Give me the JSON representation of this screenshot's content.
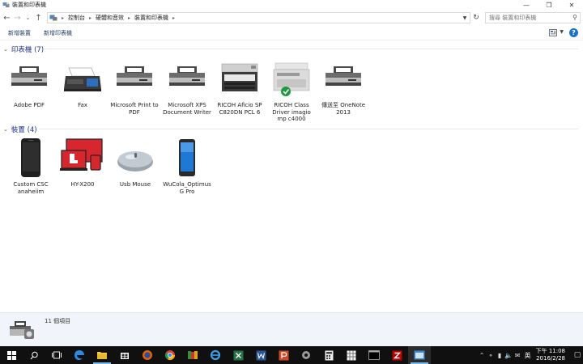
{
  "window": {
    "title": "裝置和印表機"
  },
  "address": {
    "crumbs": [
      "控制台",
      "硬體和音效",
      "裝置和印表機"
    ],
    "search_placeholder": "搜尋 裝置和印表機"
  },
  "commands": {
    "add_device": "新增裝置",
    "add_printer": "新增印表機"
  },
  "groups": {
    "printers": {
      "label": "印表機 (7)",
      "items": [
        "Adobe PDF",
        "Fax",
        "Microsoft Print to PDF",
        "Microsoft XPS Document Writer",
        "RICOH Aficio SP C820DN PCL 6",
        "RICOH Class Driver imagio mp c4000",
        "傳送至 OneNote 2013"
      ]
    },
    "devices": {
      "label": "裝置 (4)",
      "items": [
        "Custom CSC anaheiim",
        "HY-X200",
        "Usb Mouse",
        "WuCola_Optimus G Pro"
      ]
    }
  },
  "details": {
    "count": "11 個項目"
  },
  "taskbar": {
    "lang": "英",
    "time": "下午 11:08",
    "date": "2016/2/28"
  },
  "colors": {
    "accent": "#1e3287",
    "taskbar": "#101010",
    "default_badge": "#1a9b3b"
  }
}
